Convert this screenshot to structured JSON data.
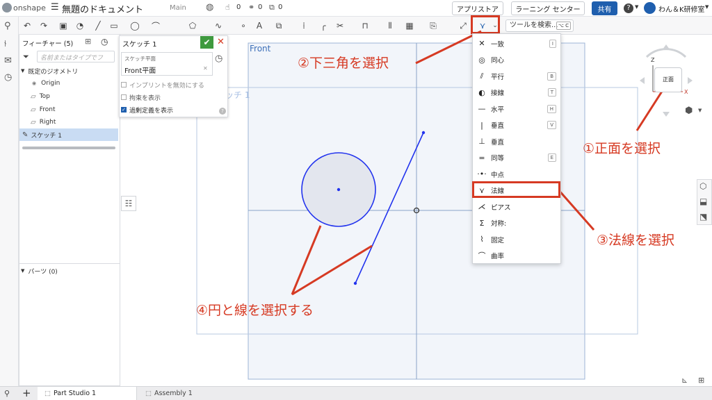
{
  "topbar": {
    "brand": "onshape",
    "doc_title": "無題のドキュメント",
    "branch": "Main",
    "likes": "0",
    "links": "0",
    "copies": "0",
    "app_store": "アプリストア",
    "learning": "ラーニング センター",
    "share": "共有",
    "help": "?",
    "user": "わん＆K研修室"
  },
  "toolbar": {
    "tool_search": "ツールを検索...",
    "shortcut": "⌥ C"
  },
  "feature_panel": {
    "title": "フィーチャー (5)",
    "filter_placeholder": "名前またはタイプでフ",
    "default_geometry": "既定のジオメトリ",
    "items": [
      "Origin",
      "Top",
      "Front",
      "Right"
    ],
    "sketch_item": "スケッチ 1",
    "parts": "パーツ (0)"
  },
  "sketch_dialog": {
    "title": "スケッチ 1",
    "plane_label": "スケッチ平面",
    "plane_value": "Front平面",
    "opt1": "インプリントを無効にする",
    "opt2": "拘束を表示",
    "opt3": "過剰定義を表示"
  },
  "canvas": {
    "plane_label": "Front",
    "sketch_label": "スケッチ 1"
  },
  "viewcube": {
    "face": "正面",
    "z_axis": "Z",
    "x_axis": "X"
  },
  "constraint_menu": {
    "items": [
      {
        "label": "一致",
        "icon": "coincident-icon",
        "glyph": "✕",
        "key": "I"
      },
      {
        "label": "同心",
        "icon": "concentric-icon",
        "glyph": "◎",
        "key": ""
      },
      {
        "label": "平行",
        "icon": "parallel-icon",
        "glyph": "⫽",
        "key": "B"
      },
      {
        "label": "接線",
        "icon": "tangent-icon",
        "glyph": "◐",
        "key": "T"
      },
      {
        "label": "水平",
        "icon": "horizontal-icon",
        "glyph": "—",
        "key": "H"
      },
      {
        "label": "垂直",
        "icon": "vertical-icon",
        "glyph": "|",
        "key": "V"
      },
      {
        "label": "垂直",
        "icon": "perpendicular-icon",
        "glyph": "⊥",
        "key": ""
      },
      {
        "label": "同等",
        "icon": "equal-icon",
        "glyph": "=",
        "key": "E"
      },
      {
        "label": "中点",
        "icon": "midpoint-icon",
        "glyph": "·•·",
        "key": ""
      },
      {
        "label": "法線",
        "icon": "normal-icon",
        "glyph": "⋎",
        "key": ""
      },
      {
        "label": "ピアス",
        "icon": "pierce-icon",
        "glyph": "⋌",
        "key": ""
      },
      {
        "label": "対称:",
        "icon": "symmetric-icon",
        "glyph": "Σ",
        "key": ""
      },
      {
        "label": "固定",
        "icon": "fix-icon",
        "glyph": "⌇",
        "key": ""
      },
      {
        "label": "曲率",
        "icon": "curvature-icon",
        "glyph": "⌒",
        "key": ""
      }
    ]
  },
  "annotations": {
    "step1": "①正面を選択",
    "step2": "②下三角を選択",
    "step3": "③法線を選択",
    "step4": "④円と線を選択する"
  },
  "bottom_tabs": {
    "part_studio": "Part Studio 1",
    "assembly": "Assembly 1"
  },
  "colors": {
    "accent": "#1f5fae",
    "annotation": "#d63a23",
    "sketch": "#2233ee"
  }
}
